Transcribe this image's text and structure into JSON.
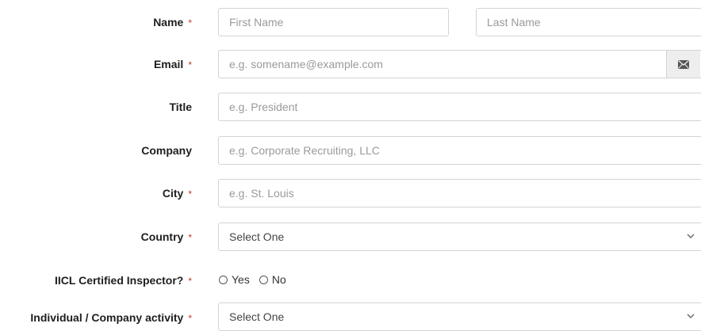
{
  "form": {
    "required_mark": "*",
    "name": {
      "label": "Name",
      "first_placeholder": "First Name",
      "last_placeholder": "Last Name"
    },
    "email": {
      "label": "Email",
      "placeholder": "e.g. somename@example.com",
      "icon": "envelope-icon"
    },
    "title": {
      "label": "Title",
      "placeholder": "e.g. President"
    },
    "company": {
      "label": "Company",
      "placeholder": "e.g. Corporate Recruiting, LLC"
    },
    "city": {
      "label": "City",
      "placeholder": "e.g. St. Louis"
    },
    "country": {
      "label": "Country",
      "selected": "Select One"
    },
    "iicl": {
      "label": "IICL Certified Inspector?",
      "options": [
        "Yes",
        "No"
      ]
    },
    "activity": {
      "label": "Individual / Company activity",
      "selected": "Select One"
    }
  },
  "colors": {
    "required": "#c0392b",
    "border": "#d3d3d3",
    "addon_bg": "#eeeeee"
  }
}
